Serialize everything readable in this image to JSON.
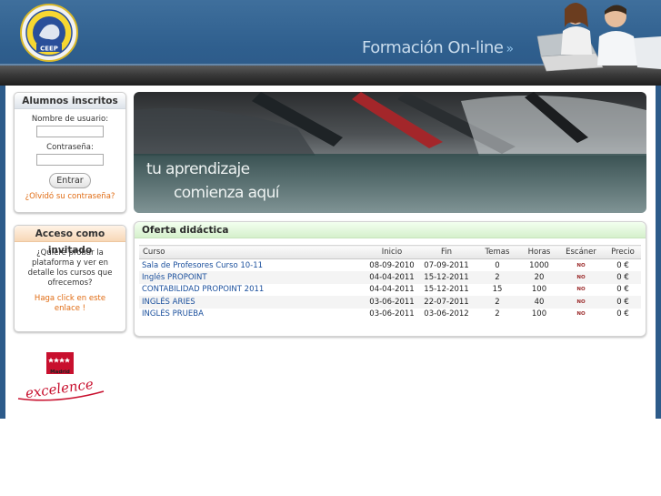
{
  "header": {
    "logo_text": "CEEP",
    "logo_ring_text": "CENTRO EUROPEO DE ESTUDIOS PROFESIONALES",
    "tagline": "Formación On-line",
    "tagline_arrows": "»"
  },
  "login": {
    "title": "Alumnos inscritos",
    "username_label": "Nombre de usuario:",
    "password_label": "Contraseña:",
    "submit_label": "Entrar",
    "forgot_link": "¿Olvidó su contraseña?"
  },
  "guest": {
    "title": "Acceso como invitado",
    "text": "¿Quiere probar la plataforma y ver en detalle los cursos que ofrecemos?",
    "link": "Haga click en este enlace !"
  },
  "madrid_logo": {
    "top_text": "Madrid",
    "script_text": "excelence"
  },
  "banner": {
    "line1": "tu aprendizaje",
    "line2": "comienza aquí"
  },
  "offer": {
    "title": "Oferta didáctica",
    "columns": [
      "Curso",
      "Inicio",
      "Fin",
      "Temas",
      "Horas",
      "Escáner",
      "Precio"
    ],
    "rows": [
      {
        "curso": "Sala de Profesores Curso 10-11",
        "inicio": "08-09-2010",
        "fin": "07-09-2011",
        "temas": "0",
        "horas": "1000",
        "escaner": "NO",
        "precio": "0 €"
      },
      {
        "curso": "Inglés PROPOINT",
        "inicio": "04-04-2011",
        "fin": "15-12-2011",
        "temas": "2",
        "horas": "20",
        "escaner": "NO",
        "precio": "0 €"
      },
      {
        "curso": "CONTABILIDAD PROPOINT 2011",
        "inicio": "04-04-2011",
        "fin": "15-12-2011",
        "temas": "15",
        "horas": "100",
        "escaner": "NO",
        "precio": "0 €"
      },
      {
        "curso": "INGLÉS ARIES",
        "inicio": "03-06-2011",
        "fin": "22-07-2011",
        "temas": "2",
        "horas": "40",
        "escaner": "NO",
        "precio": "0 €"
      },
      {
        "curso": "INGLÉS PRUEBA",
        "inicio": "03-06-2011",
        "fin": "03-06-2012",
        "temas": "2",
        "horas": "100",
        "escaner": "NO",
        "precio": "0 €"
      }
    ]
  },
  "colors": {
    "header_blue": "#2f5f8e",
    "link_orange": "#e06b12",
    "course_link_blue": "#1a4f9c",
    "offer_title_green": "#d5f0cc",
    "guest_title_peach": "#f7d7b6"
  }
}
